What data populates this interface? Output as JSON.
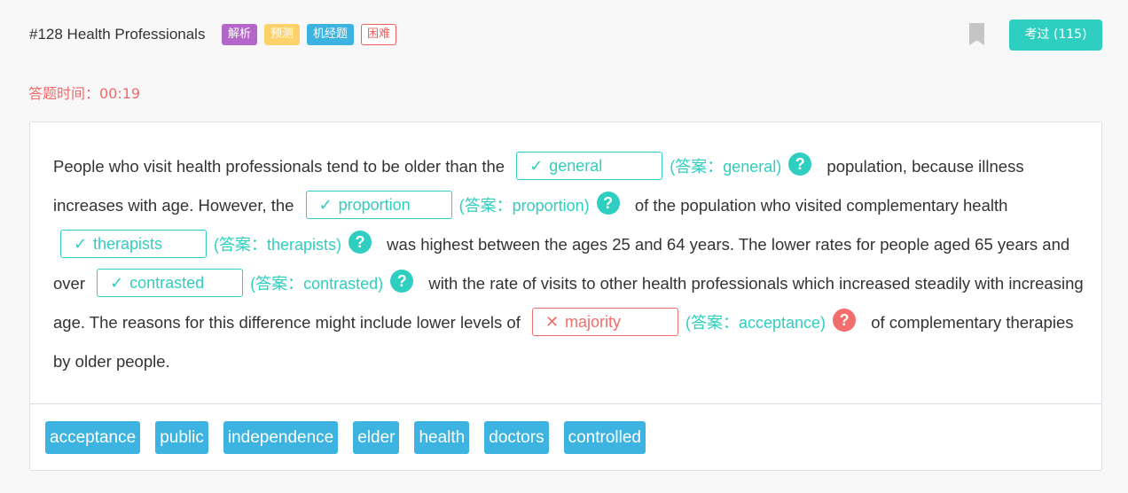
{
  "header": {
    "title": "#128 Health Professionals",
    "tags": [
      "解析",
      "预测",
      "机经题",
      "困难"
    ],
    "count_button": "考过 (115)"
  },
  "timer": {
    "text": "答题时间：00:19"
  },
  "passage": {
    "t1": "People who visit health professionals tend to be older than the",
    "g1": {
      "mark": "✓",
      "value": "general",
      "answer": "(答案：general)"
    },
    "t2": "population, because illness increases with age. However, the",
    "g2": {
      "mark": "✓",
      "value": "proportion",
      "answer": "(答案：proportion)"
    },
    "t3": "of the population who visited complementary health",
    "g3": {
      "mark": "✓",
      "value": "therapists",
      "answer": "(答案：therapists)"
    },
    "t4": "was highest between the ages 25 and 64 years. The lower rates for people aged 65 years and over",
    "g4": {
      "mark": "✓",
      "value": "contrasted",
      "answer": "(答案：contrasted)"
    },
    "t5": "with the rate of visits to other health professionals which increased steadily with increasing age. The reasons for this difference might include lower levels of",
    "g5": {
      "mark": "✕",
      "value": "majority",
      "answer": "(答案：acceptance)"
    },
    "t6": "of complementary therapies by older people.",
    "q": "?"
  },
  "options": [
    "acceptance",
    "public",
    "independence",
    "elder",
    "health",
    "doctors",
    "controlled"
  ],
  "colors": {
    "accent": "#2ecfc0",
    "error": "#f26d6d",
    "option": "#3cb3e0"
  }
}
